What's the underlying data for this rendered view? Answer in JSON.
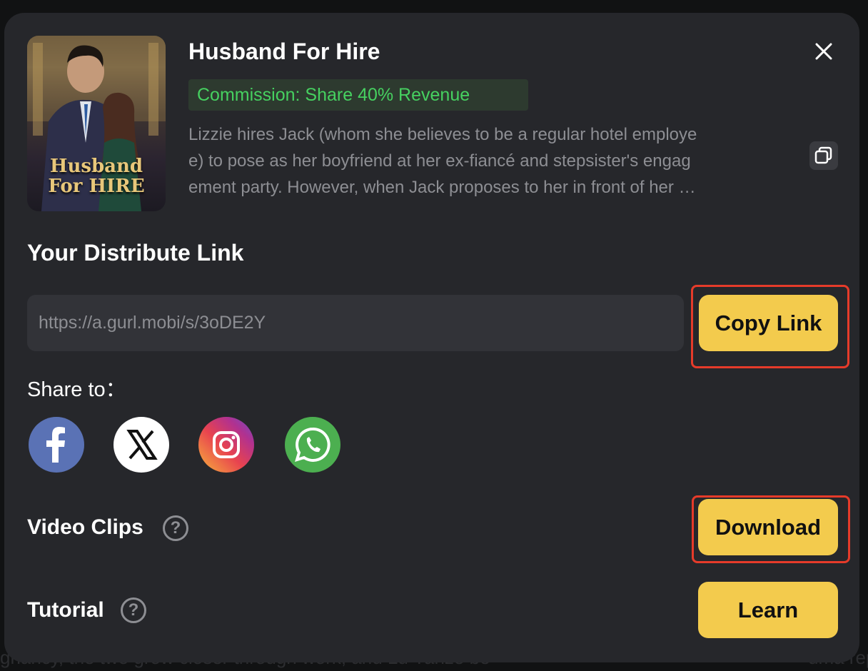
{
  "background": {
    "bottom_text": "gnancy, the two grow closer through work, and Lu Yanze be",
    "bottom_right_text": "uma repre"
  },
  "book": {
    "title": "Husband For Hire",
    "cover_title_line1": "Husband",
    "cover_title_line2": "For HIRE",
    "commission": "Commission: Share 40% Revenue",
    "description_lines": [
      "Lizzie hires Jack (whom she believes to be a regular hotel employe",
      "e) to pose as her boyfriend at her ex-fiancé and stepsister's engag",
      "ement party. However, when Jack proposes to her in front of her …"
    ]
  },
  "distribute": {
    "heading": "Your Distribute Link",
    "url": "https://a.gurl.mobi/s/3oDE2Y",
    "copy_label": "Copy Link"
  },
  "share": {
    "label": "Share to：",
    "platforms": [
      {
        "name": "facebook",
        "color": "#5a72b5"
      },
      {
        "name": "x",
        "color": "#ffffff"
      },
      {
        "name": "instagram",
        "color": "#d6307a"
      },
      {
        "name": "whatsapp",
        "color": "#4caf50"
      }
    ]
  },
  "video_clips": {
    "label": "Video Clips",
    "help": "?",
    "button": "Download"
  },
  "tutorial": {
    "label": "Tutorial",
    "help": "?",
    "button": "Learn"
  },
  "colors": {
    "modal_bg": "#26272b",
    "accent_yellow": "#f3cb4d",
    "commission_green": "#46d160",
    "highlight_red": "#e63b2a"
  },
  "icons": {
    "close": "close-icon",
    "copy_description": "copy-icon",
    "help": "question-circle-icon"
  }
}
